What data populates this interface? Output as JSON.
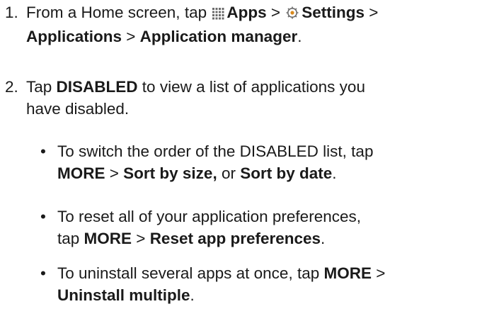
{
  "step1": {
    "number": "1.",
    "t1": "From a Home screen, tap ",
    "apps_icon": "apps-grid-icon",
    "apps": "Apps",
    "sep1": " > ",
    "settings_icon": "settings-gear-icon",
    "settings": "Settings",
    "sep2": " >",
    "applications": "Applications",
    "sep3": " > ",
    "app_manager": "Application manager",
    "period": "."
  },
  "step2": {
    "number": "2.",
    "t1": "Tap ",
    "disabled": "DISABLED",
    "t2": " to view a list of applications you",
    "t3": "have disabled."
  },
  "bullets": [
    {
      "dot": "•",
      "l1": "To switch the order of the DISABLED list, tap",
      "more": "MORE",
      "sep": " > ",
      "sort_size": "Sort by size,",
      "or": " or ",
      "sort_date": "Sort by date",
      "period": "."
    },
    {
      "dot": "•",
      "l1": "To reset all of your application preferences,",
      "tap": "tap ",
      "more": "MORE",
      "sep": " > ",
      "reset": "Reset app preferences",
      "period": "."
    },
    {
      "dot": "•",
      "l1": "To uninstall several apps at once, tap ",
      "more": "MORE",
      "sep": " >",
      "uninstall": "Uninstall multiple",
      "period": "."
    }
  ],
  "colors": {
    "text": "#1a1a1a",
    "icon_gray": "#6b6b6b",
    "icon_orange": "#d98a1e"
  }
}
